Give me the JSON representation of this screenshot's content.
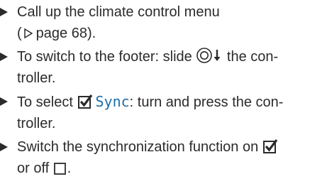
{
  "steps": [
    {
      "line1": "Call up the climate control menu",
      "line2_open": "(",
      "page_ref": "page 68",
      "line2_close": ")."
    },
    {
      "before": "To switch to the footer: slide",
      "after": "the con-",
      "line2": "troller.",
      "icon": "controller-slide-down-icon"
    },
    {
      "before": "To select",
      "sync_label": "Sync",
      "after": ": turn and press the con-",
      "line2": "troller.",
      "icon": "checked-checkbox-icon"
    },
    {
      "before": "Switch the synchronization function on",
      "line2_before": "or off",
      "line2_after": ".",
      "on_icon": "checked-checkbox-icon",
      "off_icon": "empty-checkbox-icon"
    }
  ],
  "colors": {
    "text": "#2b2b2b",
    "sync_accent": "#1f6fa8"
  }
}
